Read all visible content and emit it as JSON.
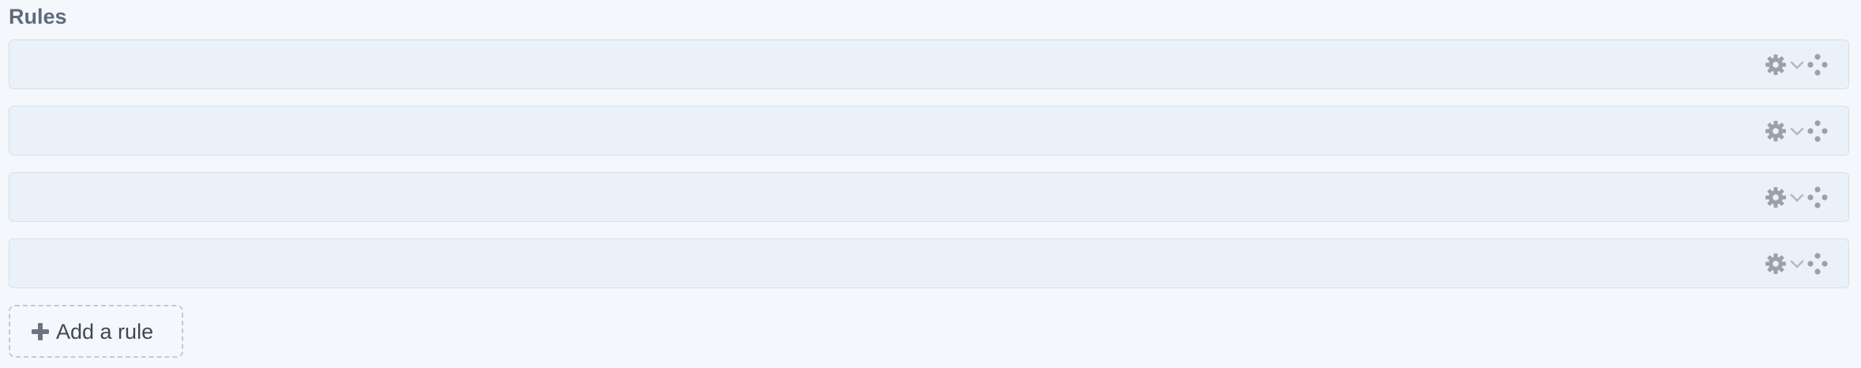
{
  "section": {
    "title": "Rules"
  },
  "rules": [
    {
      "name": "",
      "icons": [
        "gear-icon",
        "chevron-down-icon",
        "drag-handle-icon"
      ]
    },
    {
      "name": "",
      "icons": [
        "gear-icon",
        "chevron-down-icon",
        "drag-handle-icon"
      ]
    },
    {
      "name": "",
      "icons": [
        "gear-icon",
        "chevron-down-icon",
        "drag-handle-icon"
      ]
    },
    {
      "name": "",
      "icons": [
        "gear-icon",
        "chevron-down-icon",
        "drag-handle-icon"
      ]
    }
  ],
  "add_button": {
    "label": "Add a rule",
    "icon": "plus-icon"
  },
  "colors": {
    "background": "#f4f7fb",
    "row_background": "#eaf1f9",
    "row_border": "#d6dfe9",
    "icon": "#9aa1a9",
    "title": "#5f6b7a",
    "add_label": "#3f4852",
    "plus_icon": "#6b7480"
  }
}
